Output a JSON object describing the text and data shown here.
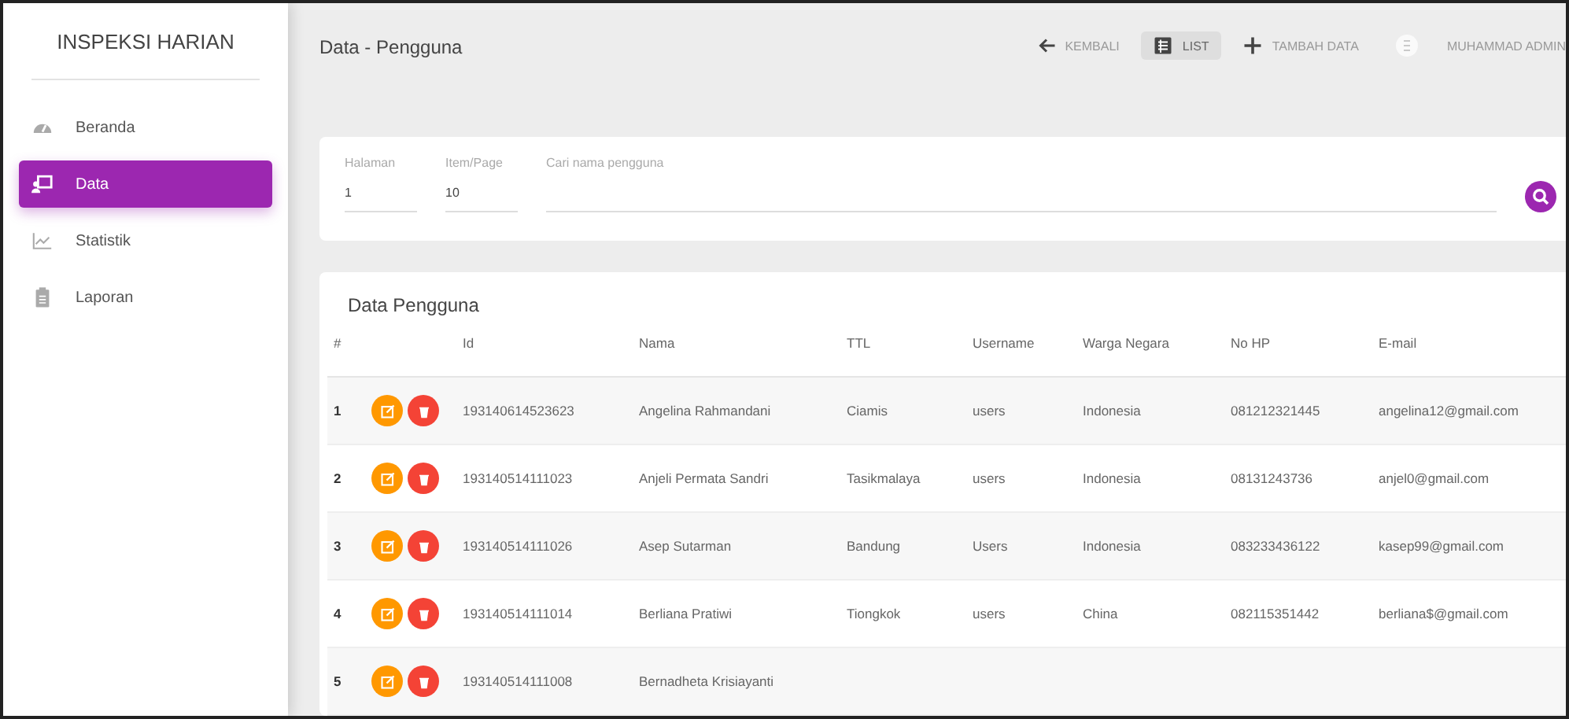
{
  "sidebar": {
    "title": "INSPEKSI HARIAN",
    "items": [
      {
        "label": "Beranda",
        "selected": false
      },
      {
        "label": "Data",
        "selected": true
      },
      {
        "label": "Statistik",
        "selected": false
      },
      {
        "label": "Laporan",
        "selected": false
      }
    ]
  },
  "topbar": {
    "title": "Data - Pengguna",
    "actions": [
      {
        "label": "KEMBALI",
        "selected": false
      },
      {
        "label": "LIST",
        "selected": true
      },
      {
        "label": "TAMBAH DATA",
        "selected": false
      }
    ],
    "user": "MUHAMMAD ADMIN"
  },
  "filters": [
    {
      "label": "Halaman",
      "value": "1",
      "kind": "small"
    },
    {
      "label": "Item/Page",
      "value": "10",
      "kind": "small"
    },
    {
      "label": "Cari nama pengguna",
      "kind": "wide"
    }
  ],
  "table": {
    "title": "Data Pengguna",
    "columns": [
      "#",
      null,
      "Id",
      "Nama",
      "TTL",
      "Username",
      "Warga Negara",
      "No HP",
      "E-mail"
    ],
    "rows": [
      {
        "cells": [
          "1",
          null,
          "193140614523623",
          "Angelina Rahmandani",
          "Ciamis",
          "users",
          "Indonesia",
          "081212321445",
          "angelina12@gmail.com"
        ]
      },
      {
        "cells": [
          "2",
          null,
          "193140514111023",
          "Anjeli Permata Sandri",
          "Tasikmalaya",
          "users",
          "Indonesia",
          "08131243736",
          "anjel0@gmail.com"
        ]
      },
      {
        "cells": [
          "3",
          null,
          "193140514111026",
          "Asep Sutarman",
          "Bandung",
          "Users",
          "Indonesia",
          "083233436122",
          "kasep99@gmail.com"
        ]
      },
      {
        "cells": [
          "4",
          null,
          "193140514111014",
          "Berliana Pratiwi",
          "Tiongkok",
          "users",
          "China",
          "082115351442",
          "berliana$@gmail.com"
        ]
      },
      {
        "cells": [
          "5",
          null,
          "193140514111008",
          "Bernadheta Krisiayanti"
        ]
      }
    ]
  }
}
